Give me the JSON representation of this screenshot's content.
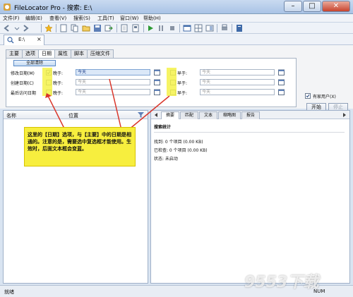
{
  "window": {
    "title": "FileLocator Pro - 搜索: E:\\"
  },
  "menu": [
    "文件(F)",
    "编辑(E)",
    "查看(V)",
    "搜索(S)",
    "工具(T)",
    "窗口(W)",
    "帮助(H)"
  ],
  "path_tab": {
    "label": "E:\\",
    "close": "×"
  },
  "criteria_tabs": [
    "主要",
    "选项",
    "日期",
    "属性",
    "脚本",
    "压缩文件"
  ],
  "active_criteria_tab": "日期",
  "date_panel": {
    "clear_all": "全部清除",
    "rows": [
      {
        "label": "修改日期(M)",
        "after_label": "晚于:",
        "after_value": "今天",
        "before_label": "早于:",
        "before_value": "今天",
        "after_checked": true,
        "before_checked": false
      },
      {
        "label": "创建日期(C)",
        "after_label": "晚于:",
        "after_value": "今天",
        "before_label": "早于:",
        "before_value": "今天",
        "after_checked": false,
        "before_checked": false
      },
      {
        "label": "最后访问日期",
        "after_label": "晚于:",
        "after_value": "今天",
        "before_label": "早于:",
        "before_value": "今天",
        "after_checked": false,
        "before_checked": false
      }
    ]
  },
  "right_controls": {
    "all_users": "有家用户(X)",
    "start": "开始",
    "stop": "停止"
  },
  "results_columns": {
    "name": "名称",
    "location": "位置"
  },
  "right_tabs": [
    "摘要",
    "匹配",
    "文本",
    "缩略图",
    "报告"
  ],
  "summary": {
    "heading": "搜索统计",
    "found": "找到: 0 个项目 (0.00 KB)",
    "checked": "已检查: 0 个项目 (0.00 KB)",
    "status": "状态: 未启动"
  },
  "callout": "这里的【日期】选项，与【主要】中的日期是相通的。注意的是，需要选中复选框才能使用。生效时，后面文本框会变蓝。",
  "status_bar": {
    "message": "就绪",
    "num": "NUM"
  },
  "watermark": "9553下载",
  "colors": {
    "highlight": "#f5f24a",
    "callout": "#f7ee3e",
    "active_field": "#dbe8f8",
    "arrow": "#d9362b"
  }
}
